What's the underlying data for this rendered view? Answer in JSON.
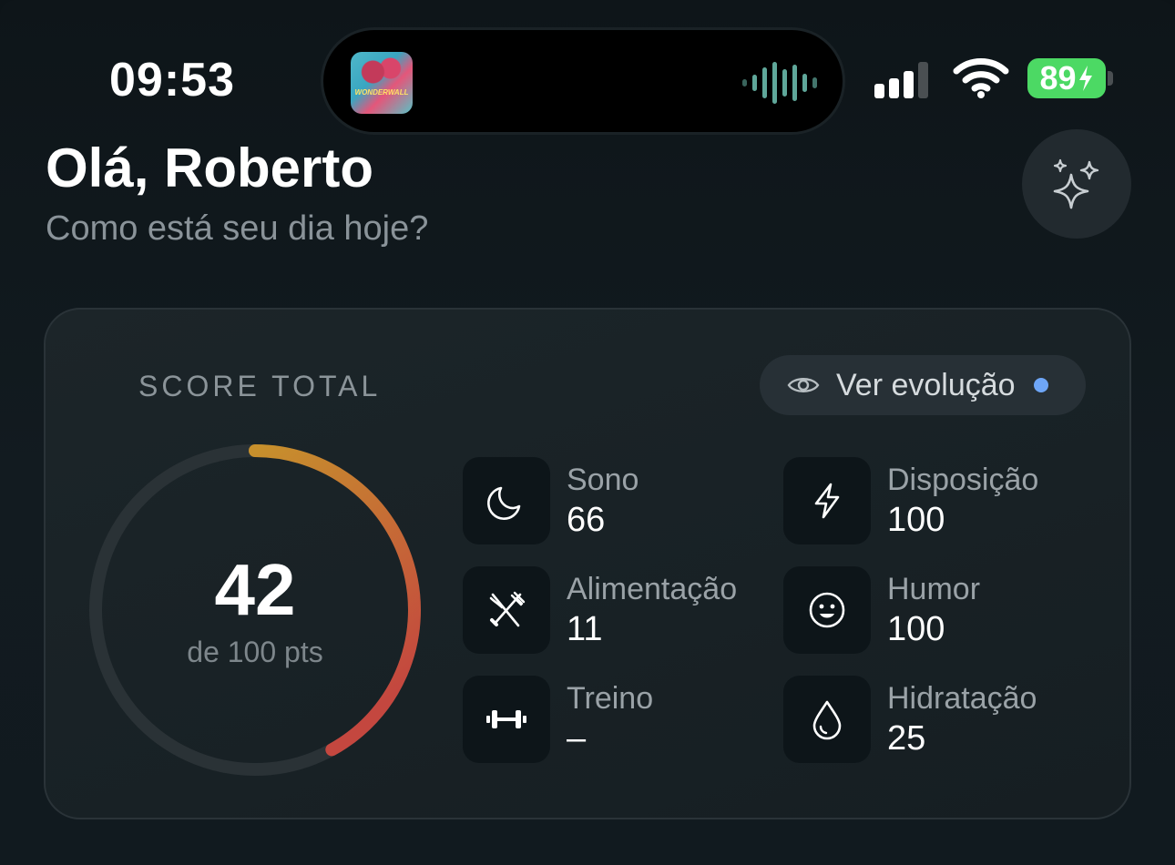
{
  "status_bar": {
    "time": "09:53",
    "now_playing": {
      "album_title": "WONDERWALL",
      "icon": "waveform-icon"
    },
    "battery_level": "89",
    "signal_bars": 3,
    "signal_bars_total": 4
  },
  "header": {
    "greeting": "Olá, Roberto",
    "subtitle": "Como está seu dia hoje?",
    "action_icon": "sparkles-icon"
  },
  "score_card": {
    "label": "SCORE TOTAL",
    "evolution_button": {
      "label": "Ver evolução",
      "icon": "eye-icon",
      "indicator_color": "#6ea6f7"
    },
    "score": "42",
    "score_max_label": "de 100 pts",
    "score_fraction": 0.42,
    "gauge_colors": {
      "start": "#c7902c",
      "end": "#c4473f",
      "track": "#2a3236"
    },
    "metrics": [
      {
        "id": "sono",
        "name": "Sono",
        "value": "66",
        "icon": "moon-icon"
      },
      {
        "id": "disposicao",
        "name": "Disposição",
        "value": "100",
        "icon": "lightning-icon"
      },
      {
        "id": "alimentacao",
        "name": "Alimentação",
        "value": "11",
        "icon": "utensils-icon"
      },
      {
        "id": "humor",
        "name": "Humor",
        "value": "100",
        "icon": "smiley-icon"
      },
      {
        "id": "treino",
        "name": "Treino",
        "value": "–",
        "icon": "dumbbell-icon"
      },
      {
        "id": "hidratacao",
        "name": "Hidratação",
        "value": "25",
        "icon": "droplet-icon"
      }
    ]
  }
}
